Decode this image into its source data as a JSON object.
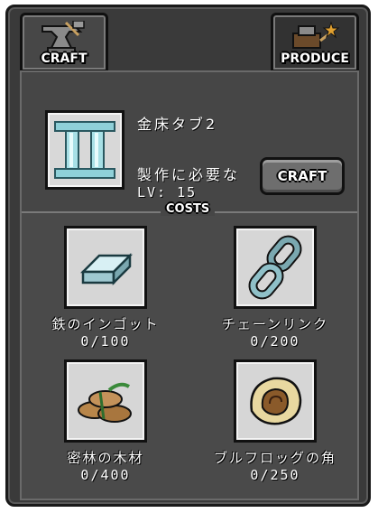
{
  "tabs": {
    "craft_label": "CRAFT",
    "produce_label": "PRODUCE"
  },
  "item": {
    "title": "金床タブ2",
    "requirement_label": "製作に必要な",
    "level": "LV: 15",
    "icon": "roman-numeral-ii-icon"
  },
  "craft_button_label": "CRAFT",
  "costs_label": "COSTS",
  "costs": [
    {
      "name": "鉄のインゴット",
      "amount": "0/100",
      "icon": "iron-ingot-icon"
    },
    {
      "name": "チェーンリンク",
      "amount": "0/200",
      "icon": "chain-link-icon"
    },
    {
      "name": "密林の木材",
      "amount": "0/400",
      "icon": "jungle-wood-icon"
    },
    {
      "name": "ブルフロッグの角",
      "amount": "0/250",
      "icon": "bullfrog-horn-icon"
    }
  ],
  "colors": {
    "panel_bg": "#3a3a3a",
    "slot_bg": "#d6d6d6",
    "text": "#ffffff"
  }
}
